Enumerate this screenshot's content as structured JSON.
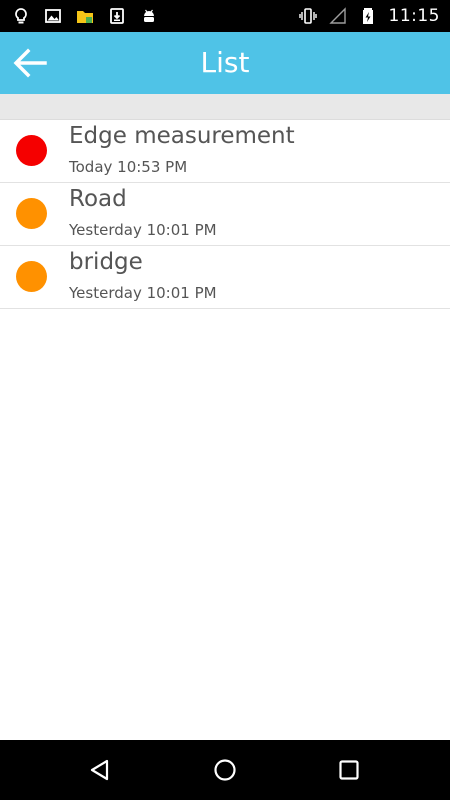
{
  "status_bar": {
    "time": "11:15",
    "left_icons": [
      "lightbulb-icon",
      "image-icon",
      "file-manager-icon",
      "download-icon",
      "android-icon"
    ],
    "right_icons": [
      "vibrate-icon",
      "no-signal-icon",
      "battery-charging-icon"
    ]
  },
  "app_bar": {
    "title": "List",
    "back_icon": "arrow-left-icon",
    "background": "#4fc3e7"
  },
  "list": {
    "items": [
      {
        "title": "Edge measurement",
        "time": "Today 10:53 PM",
        "dot_color": "#f50000"
      },
      {
        "title": "Road",
        "time": "Yesterday 10:01 PM",
        "dot_color": "#ff9100"
      },
      {
        "title": "bridge",
        "time": "Yesterday 10:01 PM",
        "dot_color": "#ff9100"
      }
    ]
  },
  "nav_bar": {
    "buttons": [
      "back-triangle-icon",
      "home-circle-icon",
      "recents-square-icon"
    ]
  }
}
